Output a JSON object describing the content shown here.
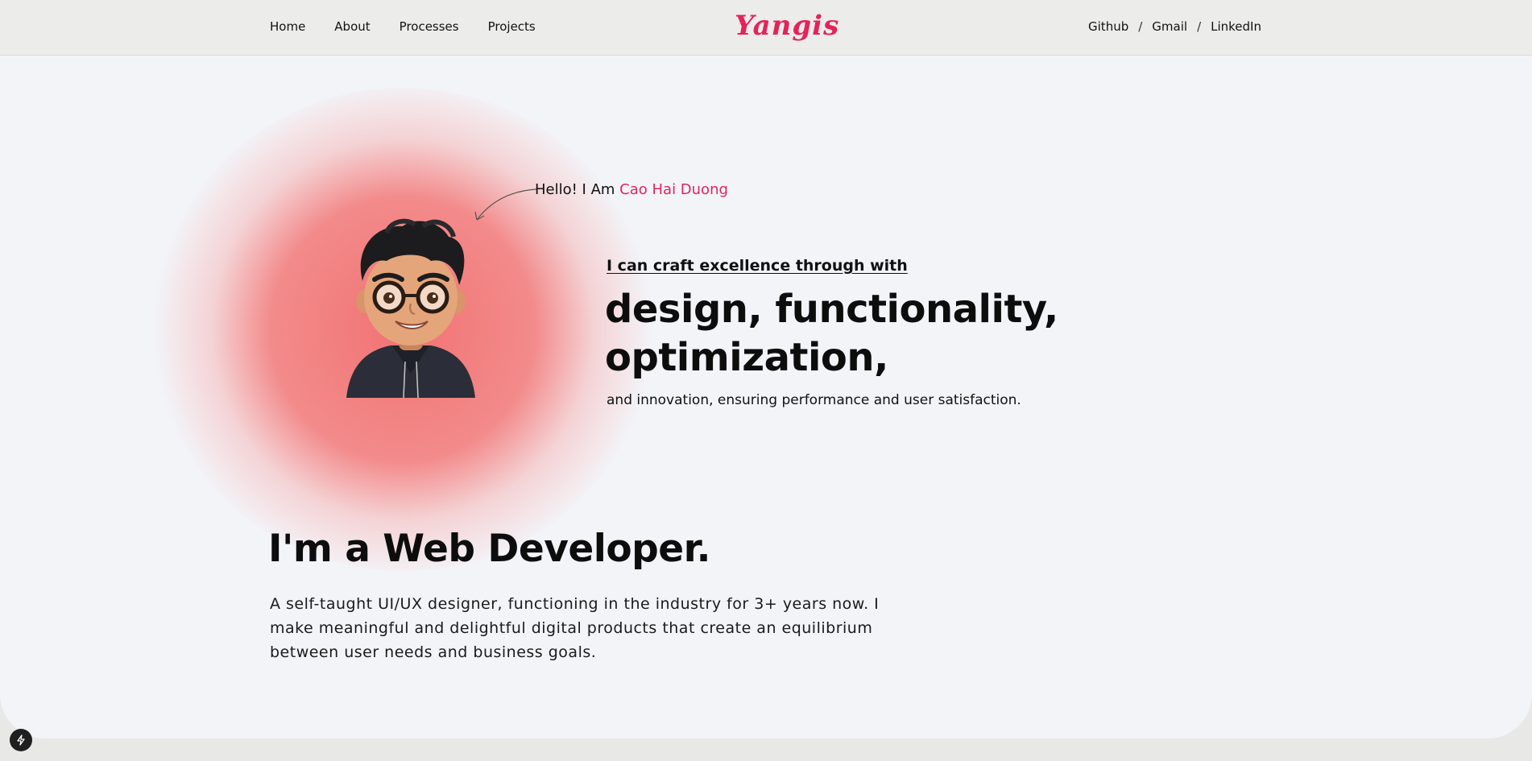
{
  "nav": {
    "links": [
      "Home",
      "About",
      "Processes",
      "Projects"
    ],
    "logo": "Yangis",
    "social": [
      "Github",
      "Gmail",
      "LinkedIn"
    ],
    "separator": "/"
  },
  "hero": {
    "greeting": "Hello! I Am ",
    "name": "Cao Hai Duong",
    "tagline": "I can craft excellence through with",
    "headline_line1": "design, functionality,",
    "headline_line2": "optimization,",
    "subline": "and innovation, ensuring performance and user satisfaction."
  },
  "about": {
    "title": "I'm a Web Developer.",
    "bio": "A self-taught UI/UX designer, functioning in the industry for 3+ years now. I make meaningful and delightful digital products that create an equilibrium between user needs and business goals."
  },
  "colors": {
    "accent": "#e3245a",
    "glow": "#f16c6c",
    "page_bg": "#f3f4f8",
    "header_bg": "#ececea"
  },
  "icons": {
    "theme_button": "palette-icon",
    "corner_button": "lightning-icon",
    "hero_arrow": "curved-arrow-icon"
  }
}
